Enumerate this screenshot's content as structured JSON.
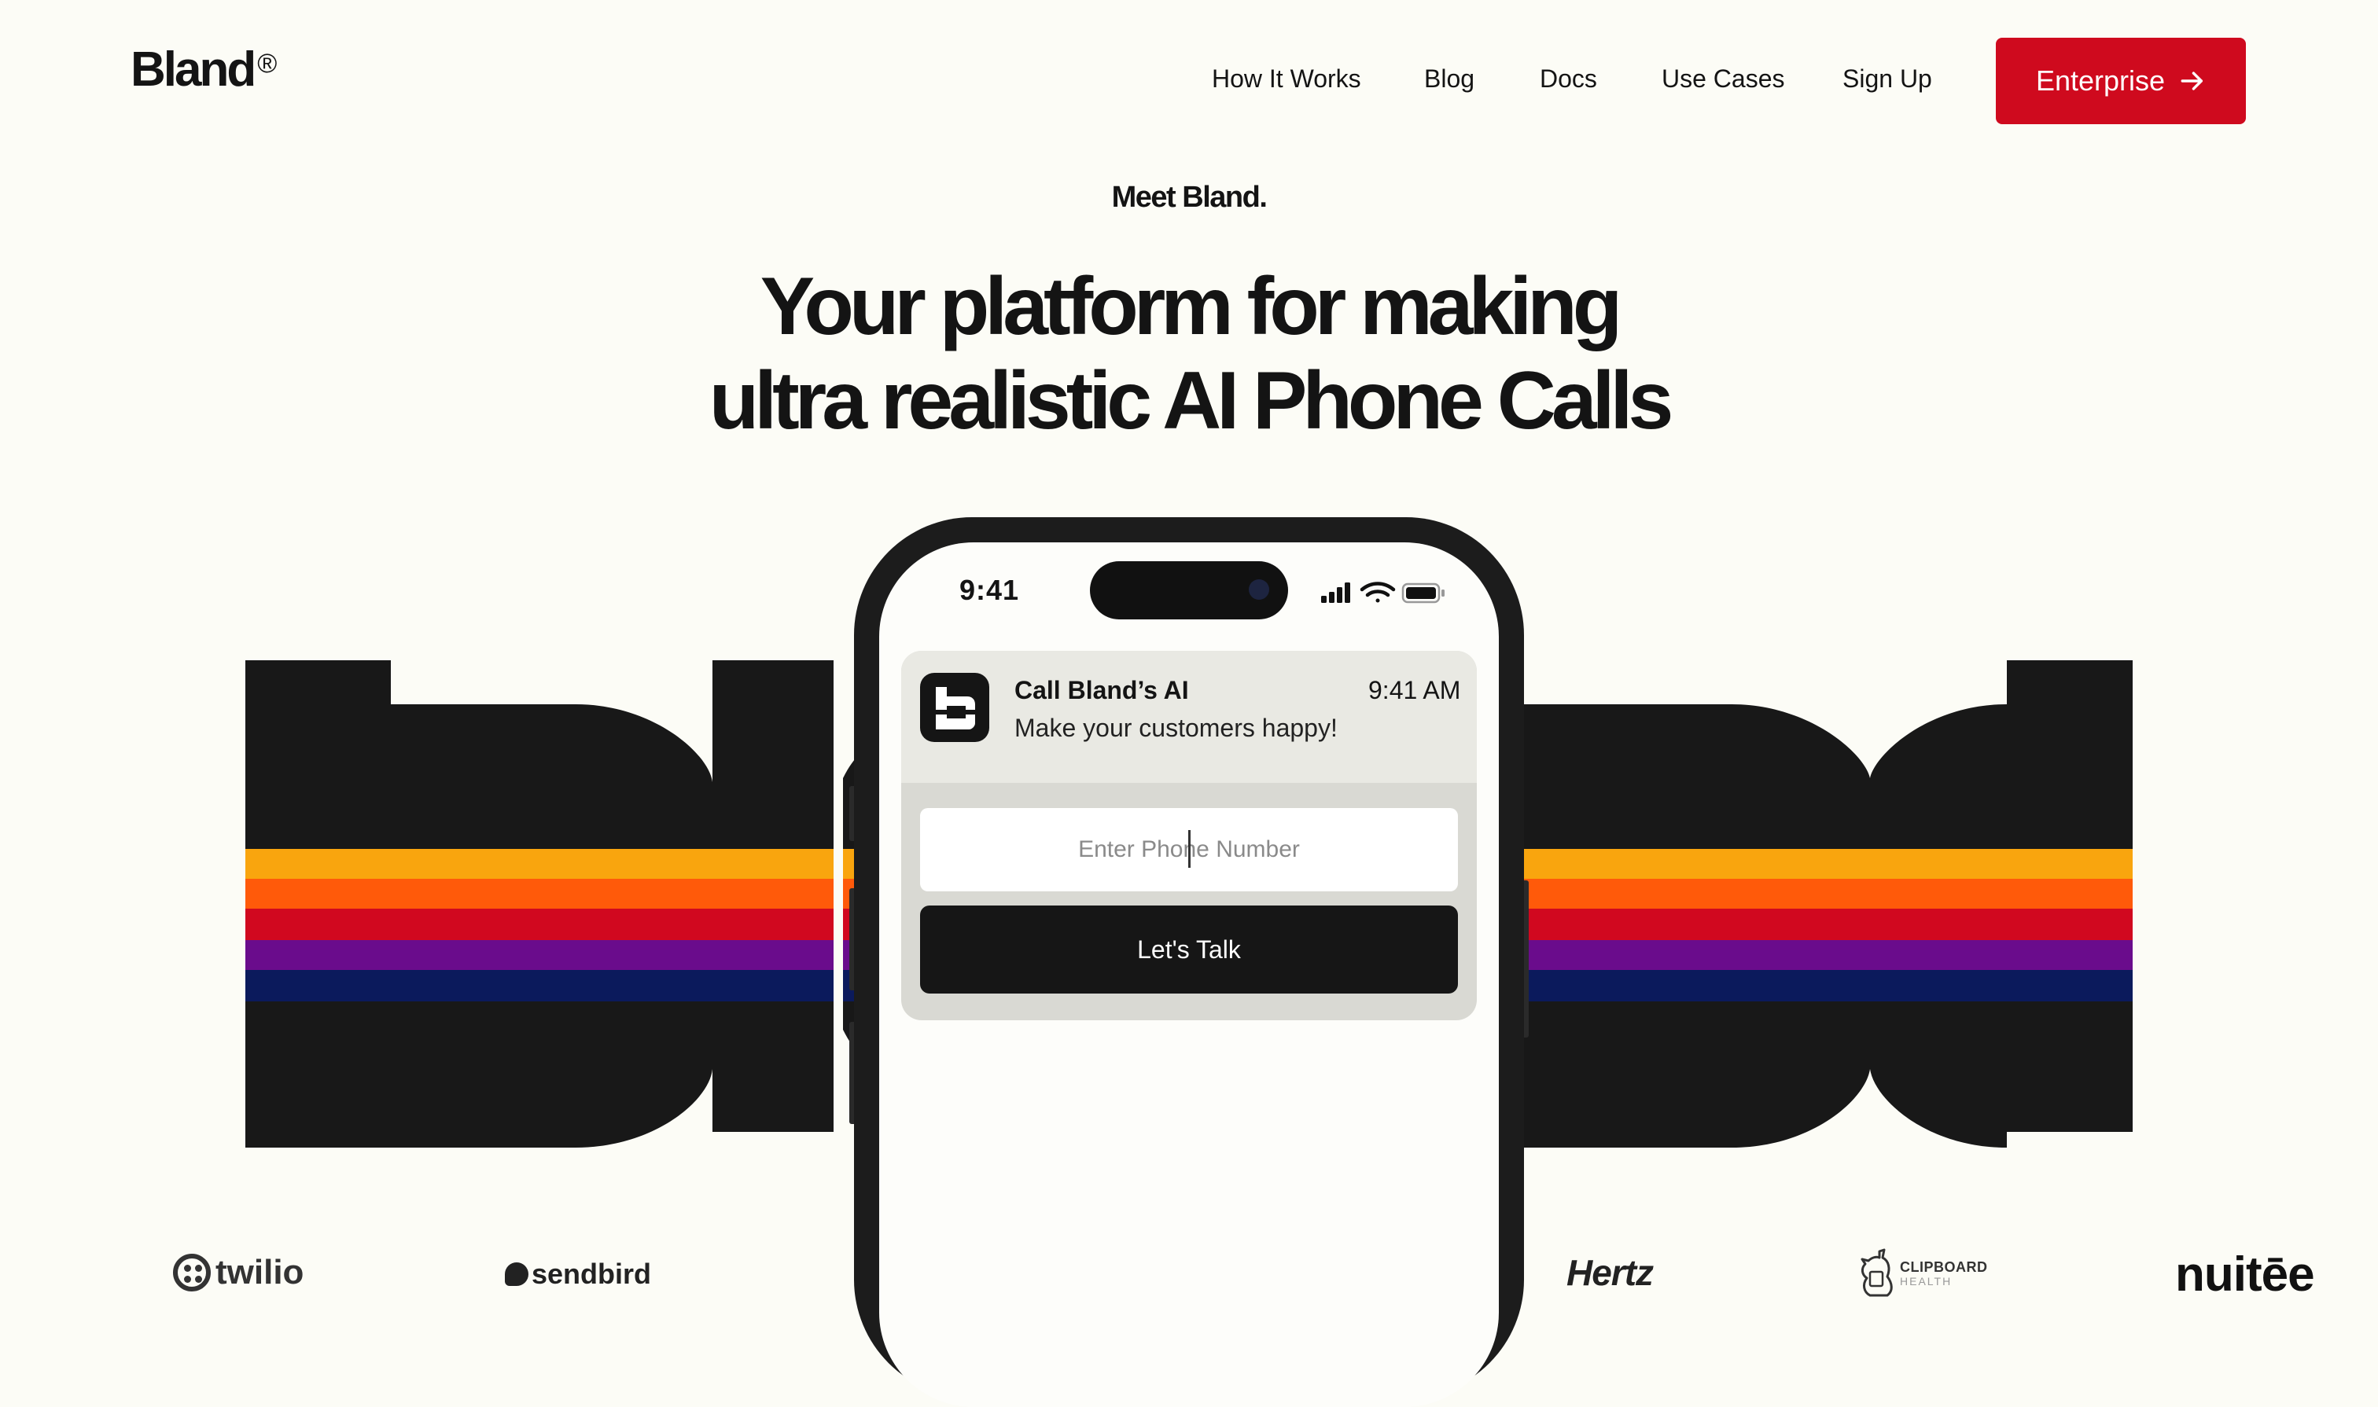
{
  "header": {
    "brand": "Bland",
    "brand_mark": "®",
    "nav": [
      "How It Works",
      "Blog",
      "Docs",
      "Use Cases",
      "Sign Up"
    ],
    "cta_label": "Enterprise",
    "cta_icon": "arrow-right-icon"
  },
  "hero": {
    "eyebrow": "Meet Bland.",
    "headline_line1": "Your platform for making",
    "headline_line2": "ultra realistic AI Phone Calls"
  },
  "phone": {
    "clock": "9:41",
    "status_icons": [
      "signal-icon",
      "wifi-icon",
      "battery-icon"
    ],
    "notification": {
      "title": "Call Bland’s AI",
      "time": "9:41 AM",
      "body": "Make your customers happy!"
    },
    "input_placeholder": "Enter Phone Number",
    "button_label": "Let's Talk"
  },
  "art": {
    "stripe_colors": [
      "#f9a50e",
      "#ff5a0a",
      "#d1081f",
      "#6a0c8c",
      "#0b1a5c"
    ],
    "letter_color": "#181818"
  },
  "logos": {
    "twilio": "twilio",
    "sendbird": "sendbird",
    "hertz": "Hertz",
    "clipboard_line1": "CLIPBOARD",
    "clipboard_line2": "HEALTH",
    "nuitee": "nuitēe"
  },
  "colors": {
    "background": "#fcfcf6",
    "accent": "#cf0a1e",
    "text": "#141414"
  }
}
